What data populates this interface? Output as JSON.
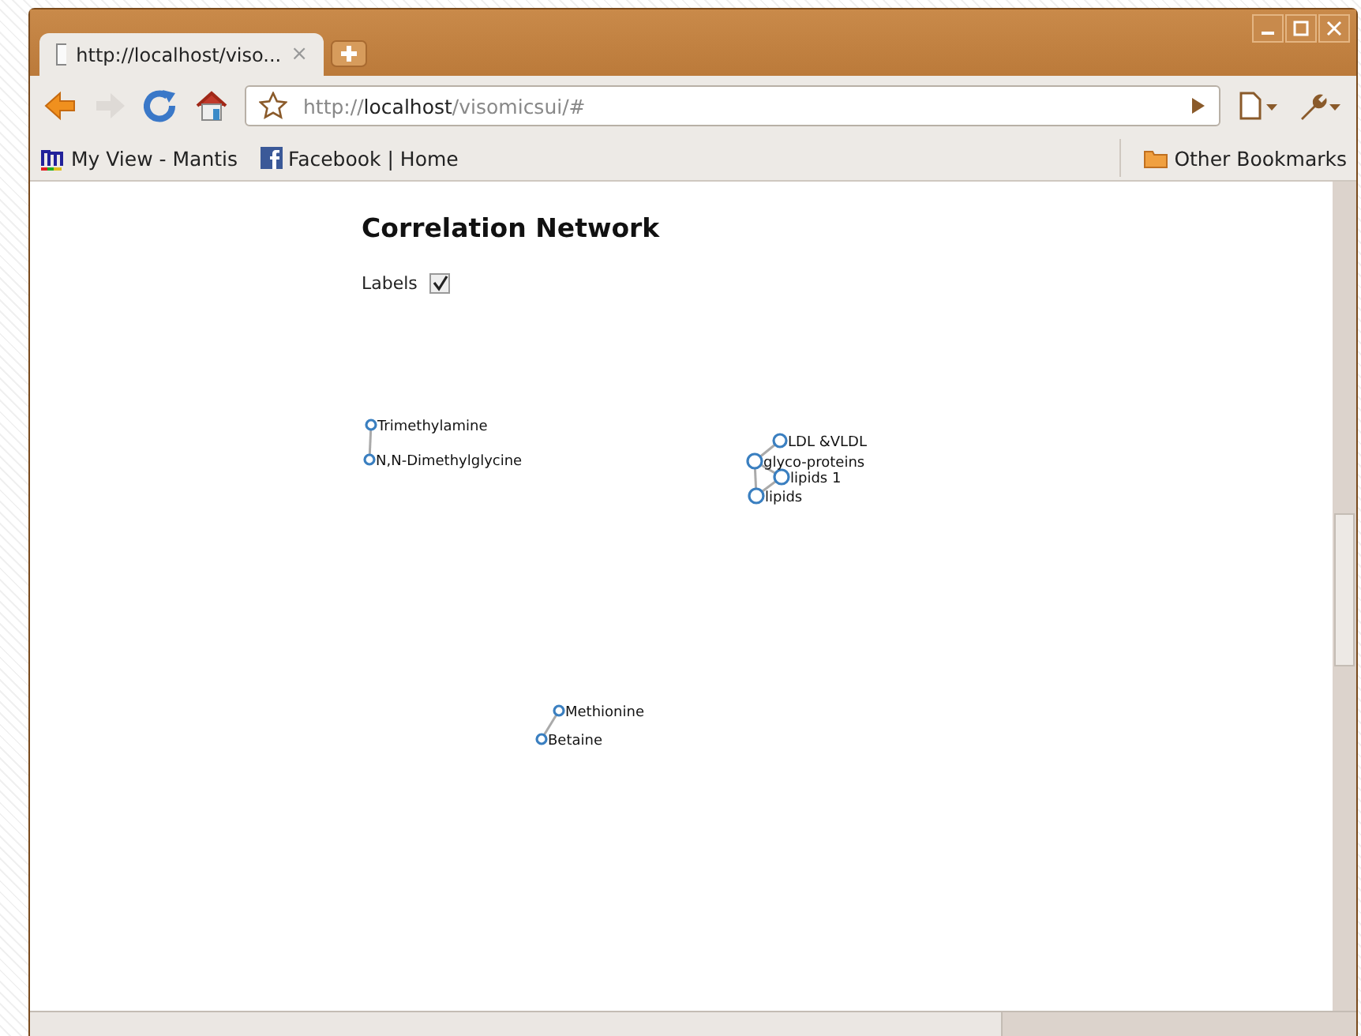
{
  "tab": {
    "title": "http://localhost/viso...",
    "close": "×"
  },
  "address_bar": {
    "prefix": "http://",
    "host": "localhost",
    "path": "/visomicsui/#"
  },
  "bookmarks": [
    {
      "label": "My View - Mantis",
      "kind": "mantis"
    },
    {
      "label": "Facebook | Home",
      "kind": "facebook"
    }
  ],
  "other_bookmarks": "Other Bookmarks",
  "page": {
    "title": "Correlation Network",
    "labels_option": {
      "label": "Labels",
      "checked": true
    }
  },
  "network": {
    "nodes": [
      {
        "label": "Trimethylamine"
      },
      {
        "label": "N,N-Dimethylglycine"
      },
      {
        "label": "LDL &VLDL"
      },
      {
        "label": "glyco-proteins"
      },
      {
        "label": "lipids 1"
      },
      {
        "label": "lipids"
      },
      {
        "label": "Methionine"
      },
      {
        "label": "Betaine"
      }
    ]
  }
}
